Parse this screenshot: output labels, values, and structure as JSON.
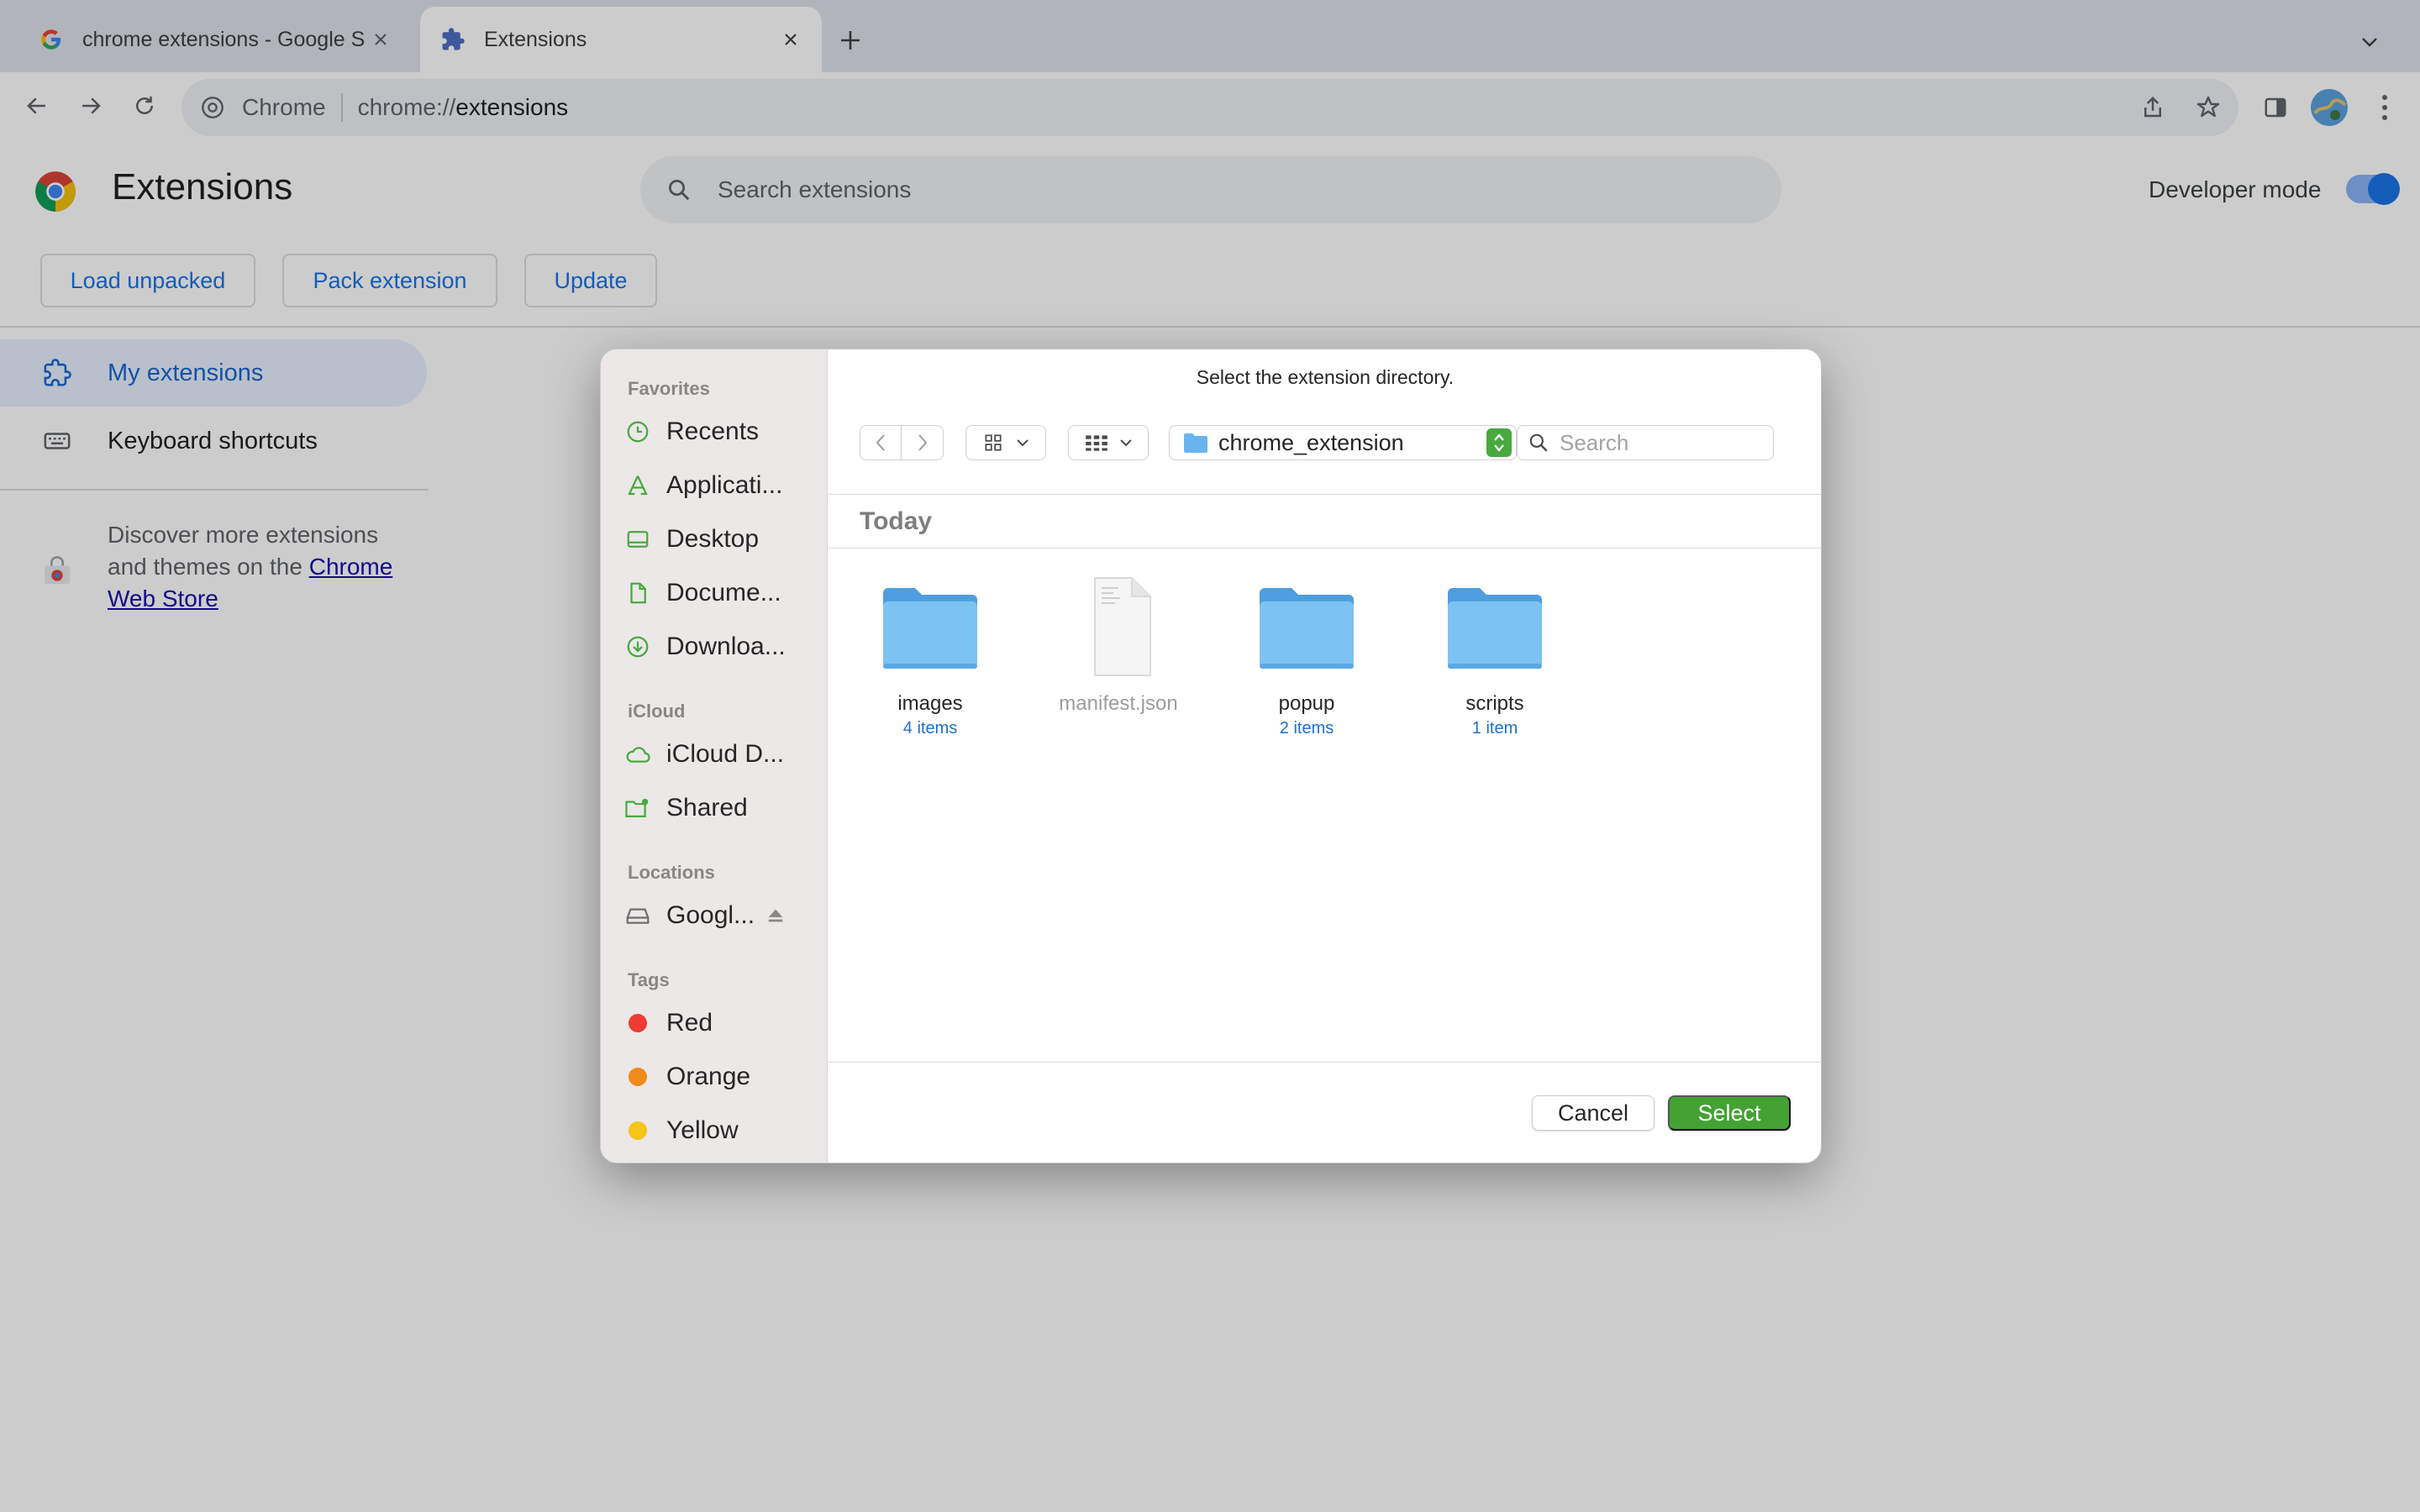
{
  "browser": {
    "tabs": [
      {
        "title": "chrome extensions - Google S",
        "active": false
      },
      {
        "title": "Extensions",
        "active": true
      }
    ],
    "omnibox": {
      "origin_label": "Chrome",
      "url_scheme": "chrome://",
      "url_host": "extensions"
    }
  },
  "extensions_page": {
    "title": "Extensions",
    "search_placeholder": "Search extensions",
    "developer_mode_label": "Developer mode",
    "developer_mode_on": true,
    "actions": {
      "load_unpacked": "Load unpacked",
      "pack_extension": "Pack extension",
      "update": "Update"
    },
    "nav": {
      "my_extensions": "My extensions",
      "keyboard_shortcuts": "Keyboard shortcuts"
    },
    "discover": {
      "text": "Discover more extensions and themes on the ",
      "link": "Chrome Web Store"
    }
  },
  "dialog": {
    "title": "Select the extension directory.",
    "sidebar": {
      "favorites_heading": "Favorites",
      "favorites": [
        "Recents",
        "Applicati...",
        "Desktop",
        "Docume...",
        "Downloa..."
      ],
      "icloud_heading": "iCloud",
      "icloud": [
        "iCloud D...",
        "Shared"
      ],
      "locations_heading": "Locations",
      "locations": [
        "Googl..."
      ],
      "tags_heading": "Tags",
      "tags": [
        {
          "name": "Red",
          "color": "#ee3b33"
        },
        {
          "name": "Orange",
          "color": "#f08a19"
        },
        {
          "name": "Yellow",
          "color": "#f5c518"
        }
      ]
    },
    "path": "chrome_extension",
    "search_placeholder": "Search",
    "section": "Today",
    "files": [
      {
        "name": "images",
        "meta": "4 items",
        "kind": "folder"
      },
      {
        "name": "manifest.json",
        "meta": "",
        "kind": "file"
      },
      {
        "name": "popup",
        "meta": "2 items",
        "kind": "folder"
      },
      {
        "name": "scripts",
        "meta": "1 item",
        "kind": "folder"
      }
    ],
    "cancel_label": "Cancel",
    "select_label": "Select"
  },
  "colors": {
    "accent": "#1a73e8",
    "select_green": "#44a235",
    "folder_blue": "#7cc3f3"
  }
}
